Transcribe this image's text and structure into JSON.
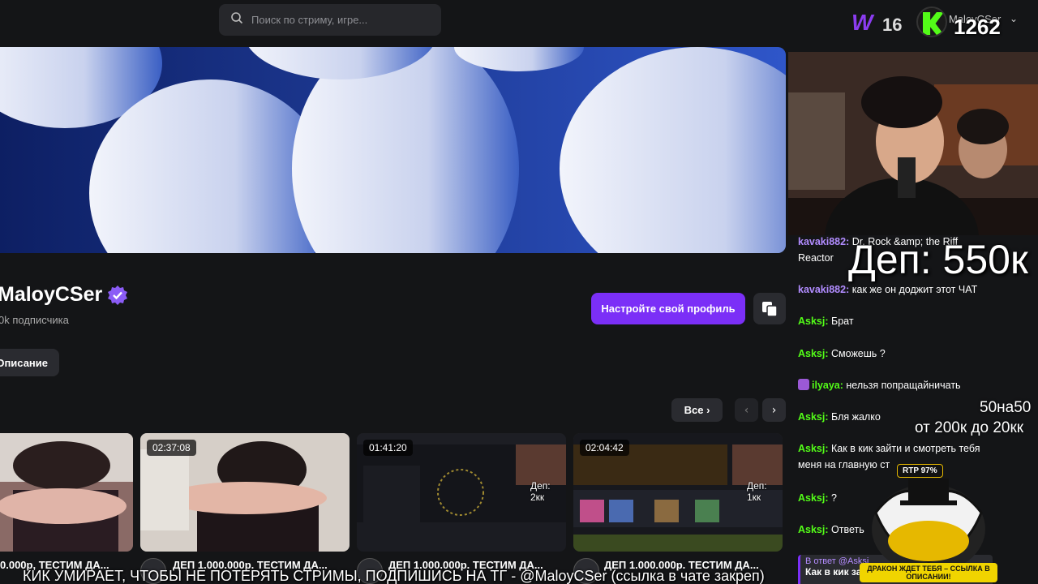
{
  "search": {
    "placeholder": "Поиск по стриму, игре..."
  },
  "header": {
    "w_count": "16",
    "username": "MaloyCSer",
    "kick_count": "1262"
  },
  "profile": {
    "name": "MaloyCSer",
    "subscribers": "0k подписчика",
    "setup_label": "Настройте свой профиль",
    "description_label": "Описание"
  },
  "videos_nav": {
    "all_label": "Все"
  },
  "videos": [
    {
      "duration": "",
      "title": "0.000р, ТЕСТИМ ДА...",
      "overlay": ""
    },
    {
      "duration": "02:37:08",
      "title": "ДЕП 1.000.000р. ТЕСТИМ ДА...",
      "overlay": ""
    },
    {
      "duration": "01:41:20",
      "title": "ДЕП 1.000.000р. ТЕСТИМ ДА...",
      "overlay": "Деп: 2кк"
    },
    {
      "duration": "02:04:42",
      "title": "ДЕП 1.000.000р. ТЕСТИМ ДА...",
      "overlay": "Деп: 1кк"
    }
  ],
  "chat": {
    "messages": [
      {
        "nick": "kavaki882:",
        "text": "Dr. Rock &amp; the Riff Reactor",
        "color": "#b18cff"
      },
      {
        "nick": "kavaki882:",
        "text": "как же он доджит этот ЧАТ",
        "color": "#b18cff"
      },
      {
        "nick": "Asksj:",
        "text": "Брат",
        "color": "#53fc18"
      },
      {
        "nick": "Asksj:",
        "text": "Сможешь ?",
        "color": "#53fc18"
      },
      {
        "nick": "ilyaya:",
        "text": "нельзя попращайничать",
        "color": "#53fc18"
      },
      {
        "nick": "Asksj:",
        "text": "Бля жалко",
        "color": "#53fc18"
      },
      {
        "nick": "Asksj:",
        "text": "Как в кик зайти и смотреть тебя меня на главную ст",
        "color": "#53fc18"
      },
      {
        "nick": "Asksj:",
        "text": "?",
        "color": "#53fc18"
      },
      {
        "nick": "Asksj:",
        "text": "Ответь",
        "color": "#53fc18"
      }
    ],
    "reply_label": "В ответ @Asksj",
    "reply_text": "Как в кик зай"
  },
  "overlays": {
    "dep_big": "Деп: 550к",
    "fifty": "50на50",
    "range": "от 200к до 20кк",
    "ticker": "КИК УМИРАЕТ, ЧТОБЫ НЕ ПОТЕРЯТЬ СТРИМЫ, ПОДПИШИСЬ НА ТГ - @MaloyCSer (ссылка в чате закреп)",
    "promo_top": "RTP 97%",
    "promo_bottom": "ДРАКОН ЖДЕТ ТЕБЯ – ССЫЛКА В ОПИСАНИИ!"
  },
  "icons": [
    "search-icon",
    "verified-icon",
    "copy-icon",
    "chevron-right-icon",
    "chevron-left-icon",
    "kick-logo-icon"
  ],
  "colors": {
    "accent": "#7b2ff7",
    "kick_green": "#53fc18",
    "background": "#141517"
  }
}
